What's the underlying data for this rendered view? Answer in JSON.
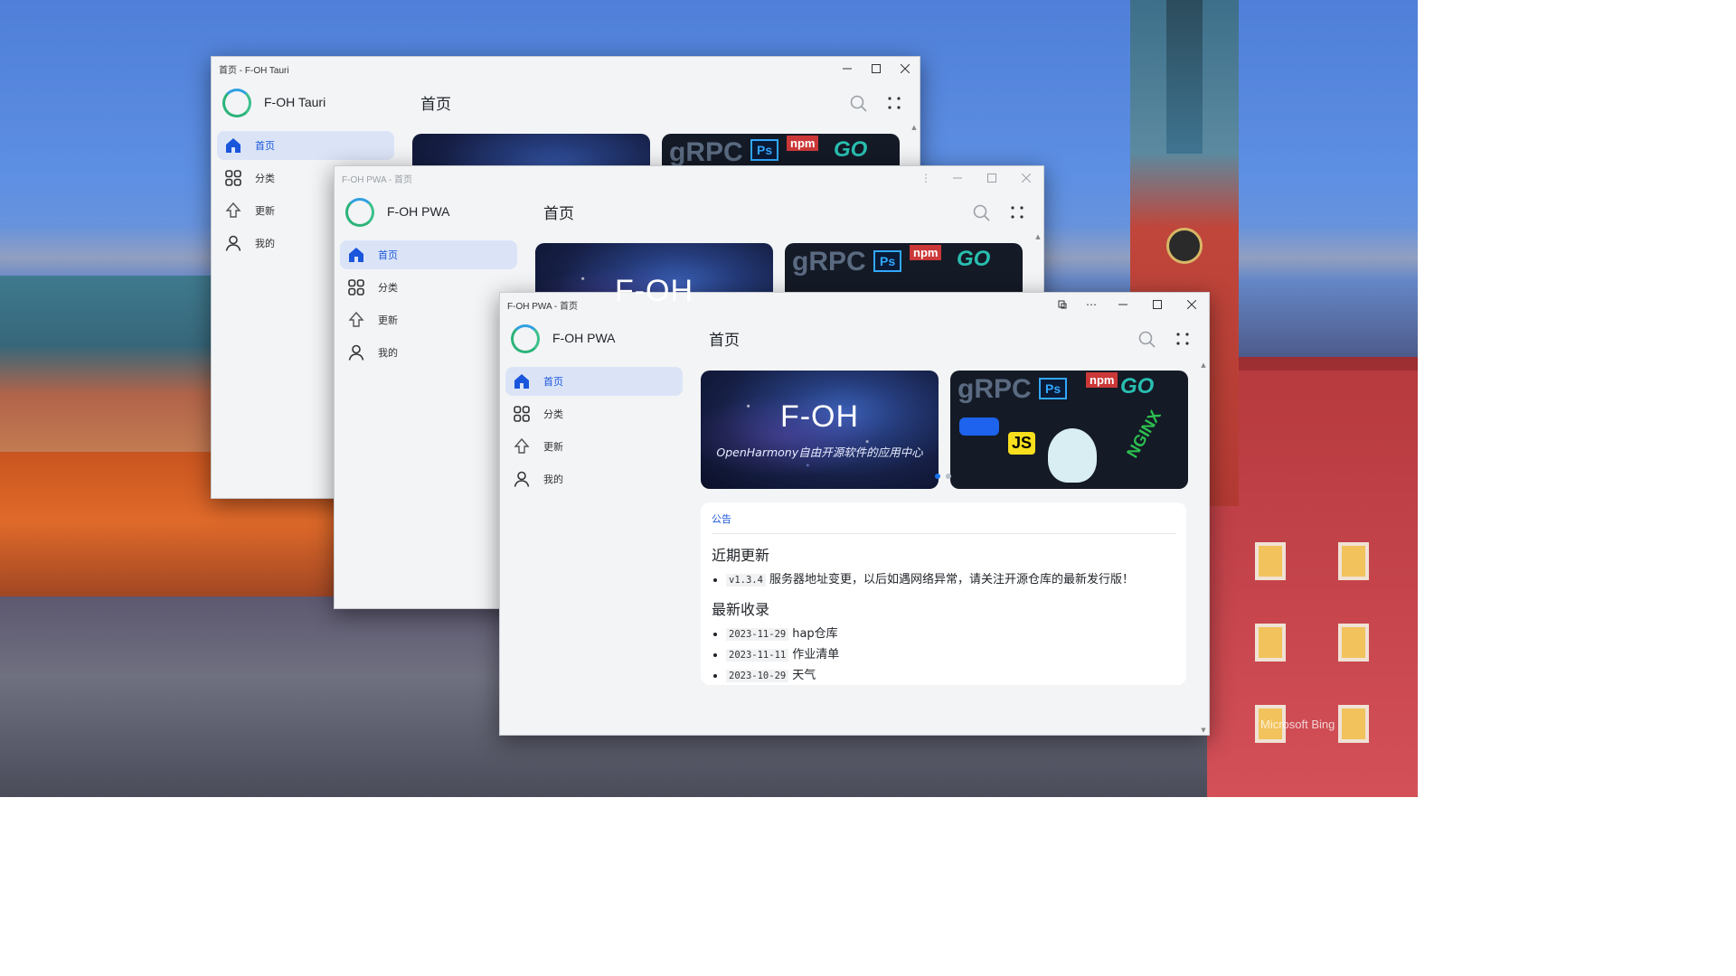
{
  "windows": {
    "tauri": {
      "title": "首页 - F-OH Tauri",
      "app_name": "F-OH Tauri",
      "page_title": "首页"
    },
    "pwa_back": {
      "title": "F-OH PWA - 首页",
      "app_name": "F-OH PWA",
      "page_title": "首页"
    },
    "pwa_front": {
      "title": "F-OH PWA - 首页",
      "app_name": "F-OH PWA",
      "page_title": "首页"
    }
  },
  "nav": [
    {
      "label": "首页",
      "icon": "home-icon",
      "active": true
    },
    {
      "label": "分类",
      "icon": "grid-icon",
      "active": false
    },
    {
      "label": "更新",
      "icon": "upload-arrow-icon",
      "active": false
    },
    {
      "label": "我的",
      "icon": "user-icon",
      "active": false
    }
  ],
  "banners": {
    "space": {
      "title": "F-OH",
      "subtitle": "OpenHarmony自由开源软件的应用中心"
    },
    "tech": {
      "tags": [
        "gRPC",
        "Ps",
        "npm",
        "GO",
        "JS",
        "NGINX"
      ]
    }
  },
  "announcement": {
    "label": "公告",
    "recent_heading": "近期更新",
    "recent": [
      {
        "code": "v1.3.4",
        "text": "服务器地址变更，以后如遇网络异常，请关注开源仓库的最新发行版！"
      }
    ],
    "latest_heading": "最新收录",
    "latest": [
      {
        "date": "2023-11-29",
        "text": "hap仓库"
      },
      {
        "date": "2023-11-11",
        "text": "作业清单"
      },
      {
        "date": "2023-10-29",
        "text": "天气"
      }
    ]
  },
  "watermark": "Microsoft Bing",
  "colors": {
    "accent": "#1a56db",
    "active_nav_bg": "#dbe4f7",
    "window_bg": "#f3f4f6"
  }
}
